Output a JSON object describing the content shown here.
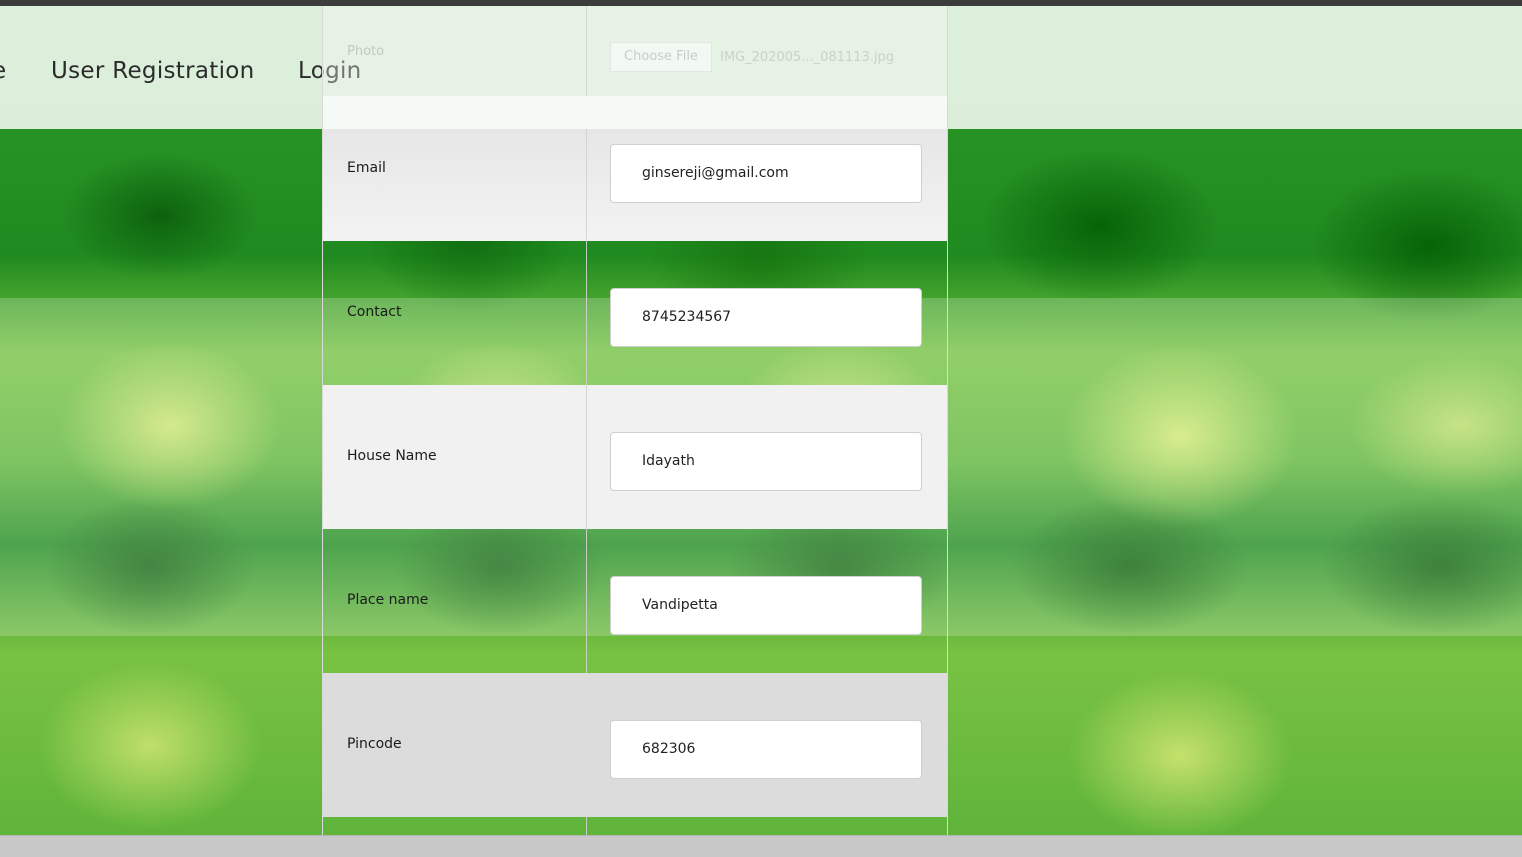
{
  "nav": {
    "partial_item": "e",
    "items": [
      {
        "label": "User Registration"
      },
      {
        "label": "Login"
      }
    ]
  },
  "form": {
    "photo": {
      "label": "Photo",
      "button": "Choose File",
      "file_name": "IMG_202005..._081113.jpg"
    },
    "email": {
      "label": "Email",
      "value": "ginsereji@gmail.com"
    },
    "contact": {
      "label": "Contact",
      "value": "8745234567"
    },
    "house_name": {
      "label": "House Name",
      "value": "Idayath"
    },
    "place_name": {
      "label": "Place name",
      "value": "Vandipetta"
    },
    "pincode": {
      "label": "Pincode",
      "value": "682306"
    }
  },
  "colors": {
    "accent_green": "#2e9a2a",
    "row_light": "#f0f0f0",
    "row_gray": "#dcdcdc",
    "text": "#1b1b1b"
  }
}
